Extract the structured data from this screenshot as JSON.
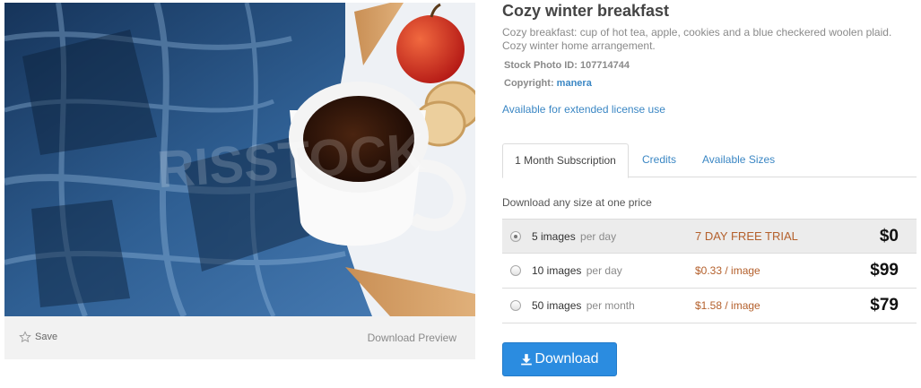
{
  "photo": {
    "watermark": "RISSTOCK",
    "save_label": "Save",
    "download_preview_label": "Download Preview"
  },
  "details": {
    "title": "Cozy winter breakfast",
    "description": "Cozy breakfast: cup of hot tea, apple, cookies and a blue checkered woolen plaid. Cozy winter home arrangement.",
    "stock_id_label": "Stock Photo ID:",
    "stock_id_value": "107714744",
    "copyright_label": "Copyright:",
    "copyright_value": "manera",
    "extended_license": "Available for extended license use"
  },
  "tabs": [
    {
      "label": "1 Month Subscription",
      "active": true
    },
    {
      "label": "Credits",
      "active": false
    },
    {
      "label": "Available Sizes",
      "active": false
    }
  ],
  "pricing": {
    "caption": "Download any size at one price",
    "plans": [
      {
        "quantity": "5 images",
        "period": "per day",
        "offer": "7 DAY FREE TRIAL",
        "price": "$0",
        "selected": true
      },
      {
        "quantity": "10 images",
        "period": "per day",
        "offer": "$0.33 / image",
        "price": "$99",
        "selected": false
      },
      {
        "quantity": "50 images",
        "period": "per month",
        "offer": "$1.58 / image",
        "price": "$79",
        "selected": false
      }
    ]
  },
  "download_button": {
    "label": "Download",
    "icon": "download-icon"
  },
  "icons": {
    "save": "star-outline-icon",
    "download": "download-arrow-icon"
  },
  "colors": {
    "link": "#3b87c4",
    "offer": "#b4602c",
    "button": "#2b8ce0",
    "selected_row": "#ececec"
  }
}
